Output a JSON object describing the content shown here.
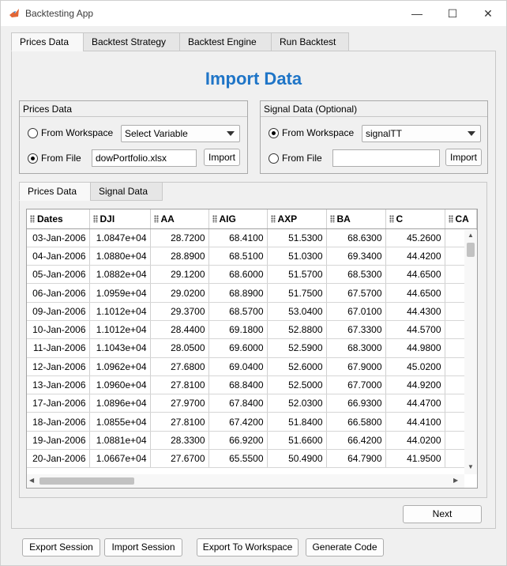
{
  "window": {
    "title": "Backtesting App",
    "minimize_glyph": "—",
    "maximize_glyph": "☐",
    "close_glyph": "✕"
  },
  "main_tabs": [
    {
      "label": "Prices Data",
      "active": true
    },
    {
      "label": "Backtest Strategy",
      "active": false
    },
    {
      "label": "Backtest Engine",
      "active": false
    },
    {
      "label": "Run Backtest",
      "active": false
    }
  ],
  "page_title": "Import Data",
  "prices_group": {
    "title": "Prices Data",
    "from_workspace_label": "From Workspace",
    "workspace_select": "Select Variable",
    "from_file_label": "From File",
    "file_value": "dowPortfolio.xlsx",
    "import_label": "Import",
    "selected": "from_file"
  },
  "signal_group": {
    "title": "Signal Data (Optional)",
    "from_workspace_label": "From Workspace",
    "workspace_select": "signalTT",
    "from_file_label": "From File",
    "file_value": "",
    "import_label": "Import",
    "selected": "from_workspace"
  },
  "data_tabs": [
    {
      "label": "Prices Data",
      "active": true
    },
    {
      "label": "Signal Data",
      "active": false
    }
  ],
  "table": {
    "columns": [
      "Dates",
      "DJI",
      "AA",
      "AIG",
      "AXP",
      "BA",
      "C",
      "CA"
    ],
    "rows": [
      [
        "03-Jan-2006",
        "1.0847e+04",
        "28.7200",
        "68.4100",
        "51.5300",
        "68.6300",
        "45.2600"
      ],
      [
        "04-Jan-2006",
        "1.0880e+04",
        "28.8900",
        "68.5100",
        "51.0300",
        "69.3400",
        "44.4200"
      ],
      [
        "05-Jan-2006",
        "1.0882e+04",
        "29.1200",
        "68.6000",
        "51.5700",
        "68.5300",
        "44.6500"
      ],
      [
        "06-Jan-2006",
        "1.0959e+04",
        "29.0200",
        "68.8900",
        "51.7500",
        "67.5700",
        "44.6500"
      ],
      [
        "09-Jan-2006",
        "1.1012e+04",
        "29.3700",
        "68.5700",
        "53.0400",
        "67.0100",
        "44.4300"
      ],
      [
        "10-Jan-2006",
        "1.1012e+04",
        "28.4400",
        "69.1800",
        "52.8800",
        "67.3300",
        "44.5700"
      ],
      [
        "11-Jan-2006",
        "1.1043e+04",
        "28.0500",
        "69.6000",
        "52.5900",
        "68.3000",
        "44.9800"
      ],
      [
        "12-Jan-2006",
        "1.0962e+04",
        "27.6800",
        "69.0400",
        "52.6000",
        "67.9000",
        "45.0200"
      ],
      [
        "13-Jan-2006",
        "1.0960e+04",
        "27.8100",
        "68.8400",
        "52.5000",
        "67.7000",
        "44.9200"
      ],
      [
        "17-Jan-2006",
        "1.0896e+04",
        "27.9700",
        "67.8400",
        "52.0300",
        "66.9300",
        "44.4700"
      ],
      [
        "18-Jan-2006",
        "1.0855e+04",
        "27.8100",
        "67.4200",
        "51.8400",
        "66.5800",
        "44.4100"
      ],
      [
        "19-Jan-2006",
        "1.0881e+04",
        "28.3300",
        "66.9200",
        "51.6600",
        "66.4200",
        "44.0200"
      ],
      [
        "20-Jan-2006",
        "1.0667e+04",
        "27.6700",
        "65.5500",
        "50.4900",
        "64.7900",
        "41.9500"
      ]
    ]
  },
  "next_label": "Next",
  "footer_buttons": [
    "Export Session",
    "Import Session",
    "Export To Workspace",
    "Generate Code"
  ],
  "colors": {
    "title_blue": "#1f75c7",
    "background": "#f0f0f0"
  }
}
